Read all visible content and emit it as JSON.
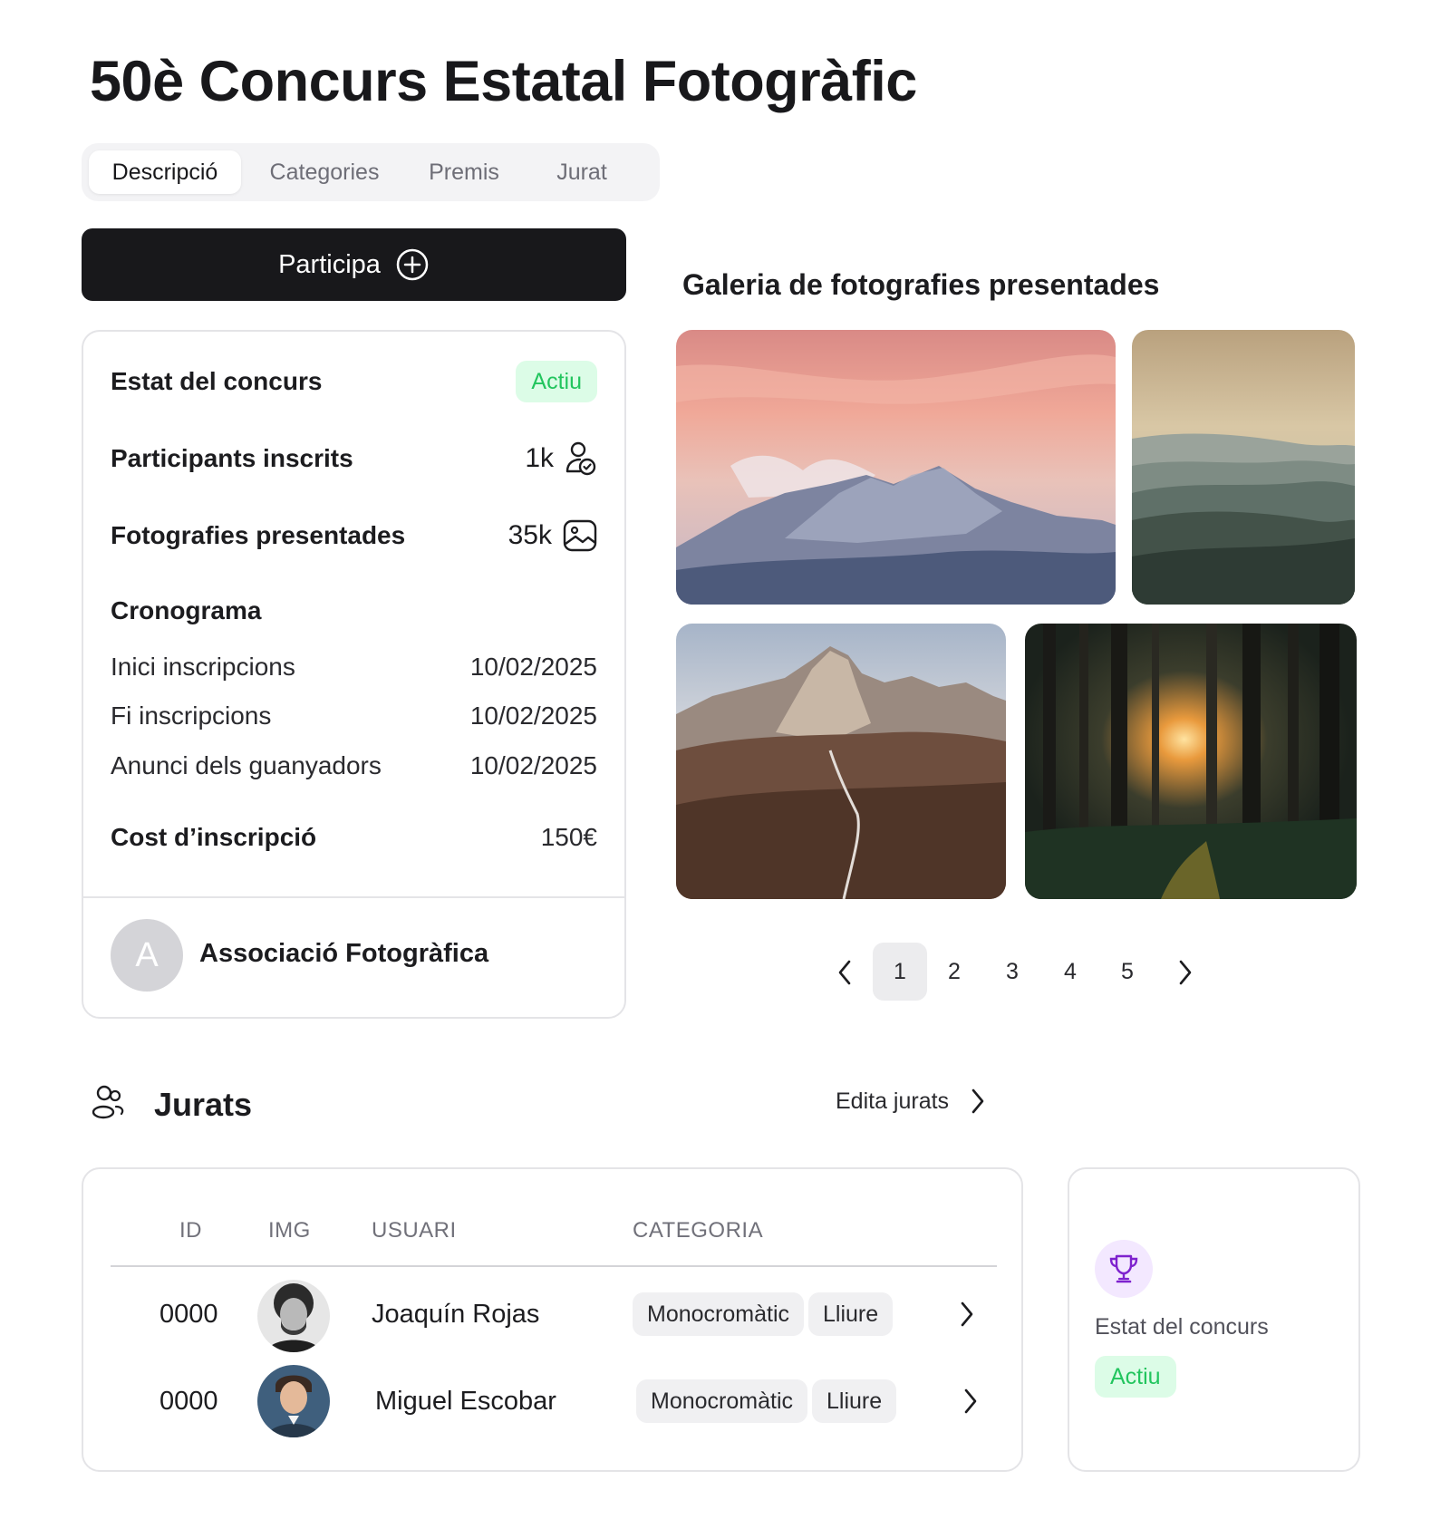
{
  "page": {
    "title": "50è Concurs Estatal Fotogràfic"
  },
  "tabs": [
    {
      "label": "Descripció",
      "active": true
    },
    {
      "label": "Categories",
      "active": false
    },
    {
      "label": "Premis",
      "active": false
    },
    {
      "label": "Jurat",
      "active": false
    }
  ],
  "cta": {
    "label": "Participa",
    "icon": "plus-circle-icon"
  },
  "info": {
    "status_label": "Estat del concurs",
    "status_value": "Actiu",
    "participants_label": "Participants inscrits",
    "participants_value": "1k",
    "participants_icon": "user-check-icon",
    "photos_label": "Fotografies presentades",
    "photos_value": "35k",
    "photos_icon": "image-icon",
    "schedule_title": "Cronograma",
    "schedule": [
      {
        "label": "Inici inscripcions",
        "date": "10/02/2025"
      },
      {
        "label": "Fi inscripcions",
        "date": "10/02/2025"
      },
      {
        "label": "Anunci dels guanyadors",
        "date": "10/02/2025"
      }
    ],
    "cost_label": "Cost d’inscripció",
    "cost_value": "150€",
    "organizer_initial": "A",
    "organizer_name": "Associació Fotogràfica"
  },
  "gallery": {
    "title": "Galeria de fotografies presentades",
    "photos": [
      "mountain-sunset",
      "misty-hills",
      "dolomites-road",
      "forest-sunbeam"
    ],
    "pages": [
      "1",
      "2",
      "3",
      "4",
      "5"
    ],
    "current_page": "1"
  },
  "jurats": {
    "title": "Jurats",
    "icon": "users-icon",
    "edit_label": "Edita jurats",
    "columns": [
      "ID",
      "IMG",
      "USUARI",
      "CATEGORIA"
    ],
    "rows": [
      {
        "id": "0000",
        "name": "Joaquín Rojas",
        "tags": [
          "Monocromàtic",
          "Lliure"
        ]
      },
      {
        "id": "0000",
        "name": "Miguel Escobar",
        "tags": [
          "Monocromàtic",
          "Lliure"
        ]
      }
    ]
  },
  "status_card": {
    "icon": "trophy-icon",
    "label": "Estat del concurs",
    "value": "Actiu"
  },
  "colors": {
    "dark": "#18181b",
    "success_bg": "#dcfce7",
    "success_text": "#22c55e",
    "accent_purple": "#7e22ce"
  }
}
